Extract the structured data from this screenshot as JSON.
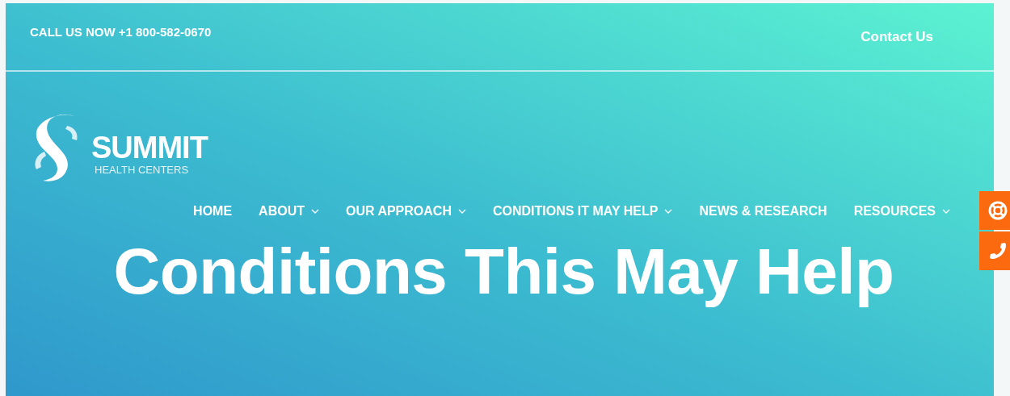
{
  "top_bar": {
    "call_text": "CALL US NOW +1 800-582-0670",
    "contact_link": "Contact Us"
  },
  "logo": {
    "name": "SUMMIT",
    "tagline": "HEALTH CENTERS"
  },
  "nav": [
    {
      "label": "HOME",
      "dropdown": false
    },
    {
      "label": "ABOUT",
      "dropdown": true
    },
    {
      "label": "OUR APPROACH",
      "dropdown": true
    },
    {
      "label": "CONDITIONS IT MAY HELP",
      "dropdown": true
    },
    {
      "label": "NEWS & RESEARCH",
      "dropdown": false
    },
    {
      "label": "RESOURCES",
      "dropdown": true
    }
  ],
  "hero": {
    "title": "Conditions This May Help"
  },
  "side_buttons": [
    {
      "kind": "support"
    },
    {
      "kind": "phone"
    }
  ]
}
